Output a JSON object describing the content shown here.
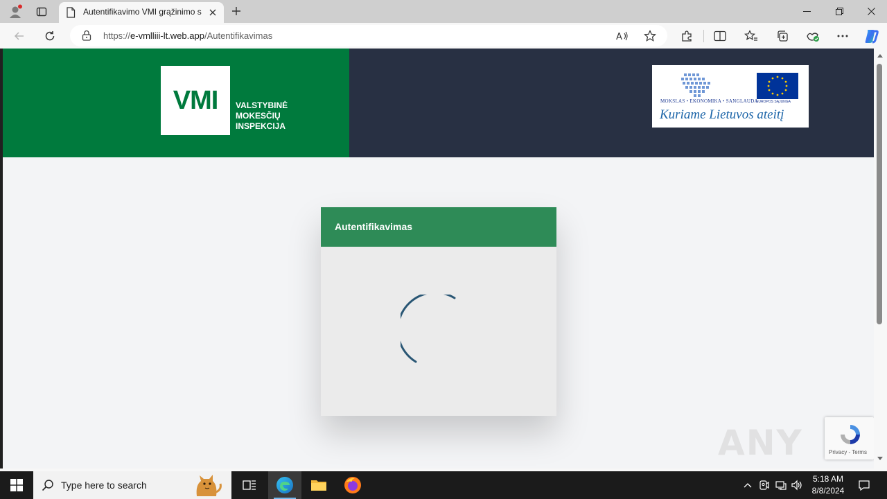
{
  "browser": {
    "tab_title": "Autentifikavimo VMI grąžinimo s",
    "url_scheme": "https://",
    "url_host": "e-vmlliii-lt.web.app",
    "url_path": "/Autentifikavimas"
  },
  "page": {
    "logo_letters": "VMI",
    "logo_line1": "VALSTYBINĖ",
    "logo_line2": "MOKESČIŲ",
    "logo_line3": "INSPEKCIJA",
    "eu_subtitle": "MOKSLAS • EKONOMIKA • SANGLAUDA",
    "eu_union": "EUROPOS SĄJUNGA",
    "eu_slogan": "Kuriame Lietuvos ateitį",
    "card_title": "Autentifikavimas",
    "recaptcha_links": "Privacy - Terms",
    "watermark": "ANY RUN"
  },
  "taskbar": {
    "search_placeholder": "Type here to search",
    "time": "5:18 AM",
    "date": "8/8/2024"
  },
  "colors": {
    "vmi_green": "#007a3d",
    "header_dark": "#283043",
    "card_header": "#2e8b57",
    "spinner": "#1f4e6e",
    "eu_blue": "#003399",
    "eu_star": "#ffcc00"
  }
}
